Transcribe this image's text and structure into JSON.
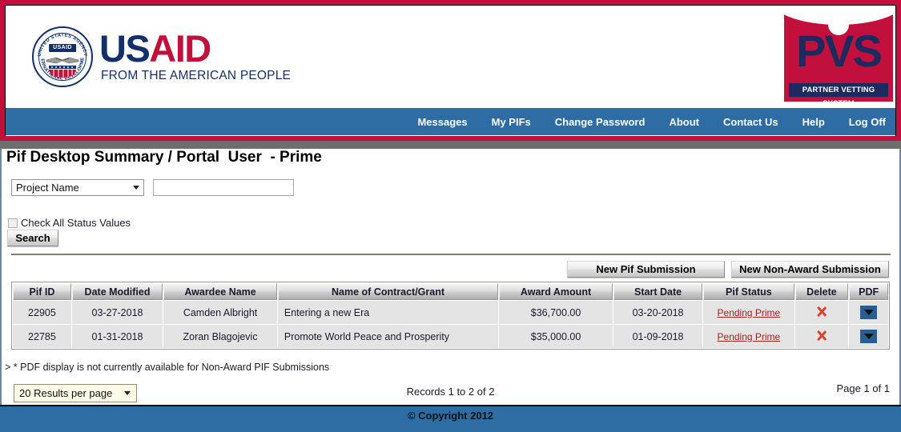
{
  "header": {
    "usaid_logo": {
      "seal_text_top": "UNITED STATES AGENCY",
      "seal_text_bottom": "INTERNATIONAL DEVELOPMENT",
      "seal_badge": "USAID",
      "word_us": "US",
      "word_aid": "AID",
      "tagline": "FROM THE AMERICAN PEOPLE"
    },
    "pvs_logo": {
      "acronym": "PVS",
      "subtitle": "PARTNER VETTING SYSTEM"
    },
    "nav": [
      {
        "label": "Messages",
        "name": "nav-messages"
      },
      {
        "label": "My PIFs",
        "name": "nav-my-pifs"
      },
      {
        "label": "Change Password",
        "name": "nav-change-password"
      },
      {
        "label": "About",
        "name": "nav-about"
      },
      {
        "label": "Contact Us",
        "name": "nav-contact-us"
      },
      {
        "label": "Help",
        "name": "nav-help"
      },
      {
        "label": "Log Off",
        "name": "nav-log-off"
      }
    ]
  },
  "page": {
    "title": "Pif Desktop Summary / Portal  User  - Prime"
  },
  "filters": {
    "field_select_value": "Project Name",
    "field_select_options": [
      "Project Name"
    ],
    "search_value": "",
    "search_placeholder": "",
    "check_all_label": "Check All Status Values",
    "check_all_checked": false,
    "search_button": "Search"
  },
  "actions": {
    "new_pif": "New Pif Submission",
    "new_non_award": "New Non-Award Submission"
  },
  "table": {
    "columns": [
      "Pif ID",
      "Date Modified",
      "Awardee Name",
      "Name of Contract/Grant",
      "Award Amount",
      "Start Date",
      "Pif Status",
      "Delete",
      "PDF"
    ],
    "rows": [
      {
        "pif_id": "22905",
        "date_modified": "03-27-2018",
        "awardee_name": "Camden Albright",
        "contract_name": "Entering a new Era",
        "award_amount": "$36,700.00",
        "start_date": "03-20-2018",
        "status": "Pending Prime",
        "delete_icon": "red-x-icon",
        "pdf_icon": "pdf-dropdown-icon"
      },
      {
        "pif_id": "22785",
        "date_modified": "01-31-2018",
        "awardee_name": "Zoran Blagojevic",
        "contract_name": "Promote World Peace and Prosperity",
        "award_amount": "$35,000.00",
        "start_date": "01-09-2018",
        "status": "Pending Prime",
        "delete_icon": "red-x-icon",
        "pdf_icon": "pdf-dropdown-icon"
      }
    ]
  },
  "pagination": {
    "note": "> * PDF display is not currently available for Non-Award PIF Submissions",
    "results_per_page": "20 Results per page",
    "results_per_page_options": [
      "20 Results per page"
    ],
    "records": "Records 1 to 2 of 2",
    "page": "Page 1 of 1"
  },
  "footer": {
    "copyright": "© Copyright 2012"
  },
  "colors": {
    "brand_red": "#c2103c",
    "brand_navy": "#1d2a60",
    "nav_blue": "#2e6da4",
    "gray_band": "#6e6e6e",
    "status_link": "#9c2121",
    "row_bg": "#e4e4e4"
  }
}
